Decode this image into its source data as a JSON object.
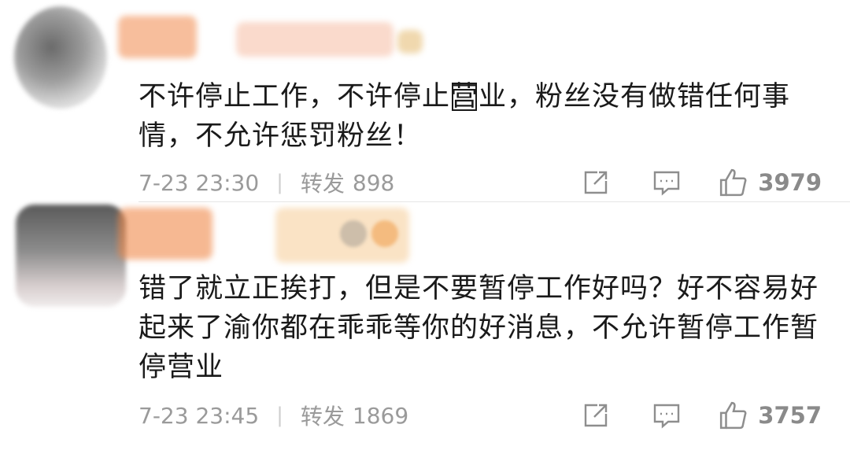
{
  "comments": [
    {
      "text_parts": [
        "不许停止工作，不许停止",
        "营",
        "业，粉丝没有做错任何事情，不允许惩罚粉丝！"
      ],
      "timestamp": "7-23 23:30",
      "repost_label": "转发",
      "repost_count": "898",
      "like_count": "3979"
    },
    {
      "text": "错了就立正挨打，但是不要暂停工作好吗？好不容易好起来了渝你都在乖乖等你的好消息，不允许暂停工作暂停营业",
      "timestamp": "7-23 23:45",
      "repost_label": "转发",
      "repost_count": "1869",
      "like_count": "3757"
    }
  ],
  "colors": {
    "text": "#1a1a1a",
    "meta": "#9a9a9a",
    "name_blur": "#f0884a",
    "icon": "#8e8e8e"
  },
  "icons": [
    "share-icon",
    "comment-icon",
    "like-icon"
  ]
}
